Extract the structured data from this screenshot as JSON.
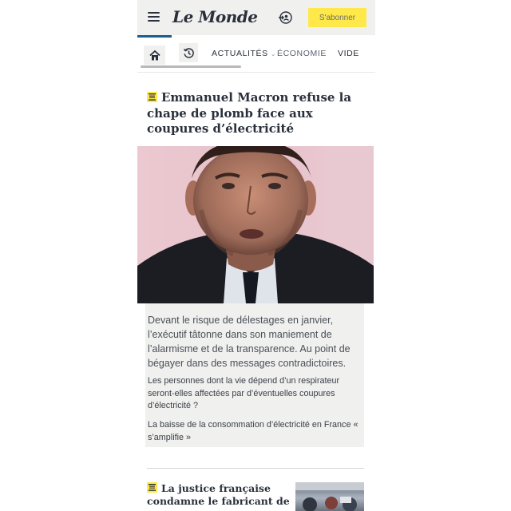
{
  "header": {
    "logo": "Le Monde",
    "subscribe_label": "S'abonner"
  },
  "nav": {
    "items": [
      "ACTUALITÉS",
      "ÉCONOMIE",
      "VIDE"
    ]
  },
  "lead_article": {
    "title": "Emmanuel Macron refuse la chape de plomb face aux coupures d’électricité",
    "summary": "Devant le risque de délestages en janvier, l’exécutif tâtonne dans son maniement de l’alarmisme et de la transparence. Au point de bégayer dans des messages contradictoires.",
    "related": [
      "Les personnes dont la vie dépend d’un respirateur seront-elles affectées par d’éventuelles coupures d’électricité ?",
      "La baisse de la consommation d’électricité en France « s’amplifie »"
    ]
  },
  "second_article": {
    "title": "La justice française condamne le fabricant de"
  },
  "colors": {
    "accent_yellow": "#ffe94a",
    "active_tab": "#1a5d8f",
    "text": "#2a303b"
  },
  "icons": [
    "menu-icon",
    "login-icon",
    "home-icon",
    "history-icon",
    "live-badge-icon"
  ]
}
